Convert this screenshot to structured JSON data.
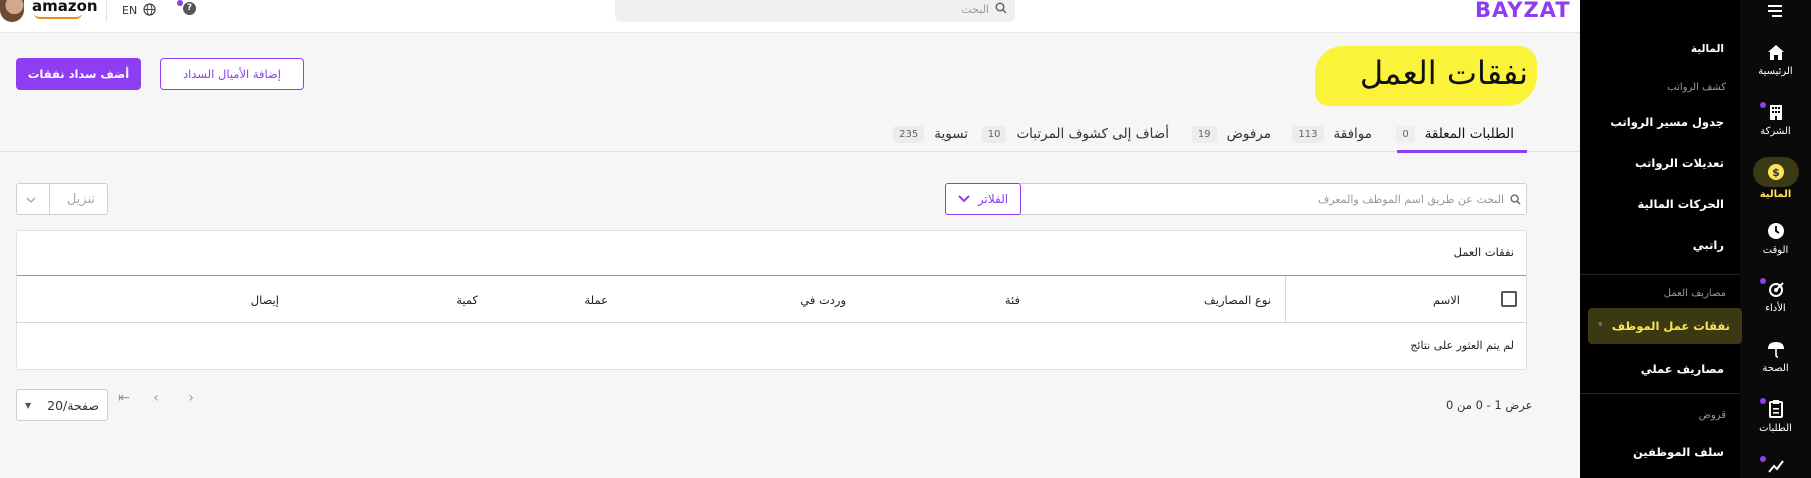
{
  "app": {
    "logo": "BAYZAT",
    "language": "EN",
    "company_logo": "amazon"
  },
  "search": {
    "placeholder": "البحث"
  },
  "rail": {
    "items": [
      {
        "label": "الرئيسية",
        "icon": "home-icon"
      },
      {
        "label": "الشركة",
        "icon": "building-icon"
      },
      {
        "label": "المالية",
        "icon": "dollar-icon",
        "active": true
      },
      {
        "label": "الوقت",
        "icon": "clock-icon"
      },
      {
        "label": "الأداء",
        "icon": "performance-icon"
      },
      {
        "label": "الصحة",
        "icon": "health-icon"
      },
      {
        "label": "الطلبات",
        "icon": "requests-icon"
      }
    ]
  },
  "subnav": {
    "header": "المالية",
    "sections": [
      {
        "title": "كشف الرواتب",
        "items": [
          "جدول مسير الرواتب",
          "تعديلات الرواتب",
          "الحركات المالية",
          "راتبي"
        ]
      },
      {
        "title": "مصاريف العمل",
        "items": [
          "نفقات عمل الموظف",
          "مصاريف عملي"
        ]
      },
      {
        "title": "قروض",
        "items": [
          "سلف الموظفين"
        ]
      }
    ],
    "active_item": "نفقات عمل الموظف"
  },
  "page": {
    "title": "نفقات العمل",
    "add_button": "أضف سداد نفقات",
    "miles_button": "إضافة الأميال السداد"
  },
  "tabs": [
    {
      "label": "الطلبات المعلقة",
      "count": "0",
      "active": true
    },
    {
      "label": "موافقة",
      "count": "113"
    },
    {
      "label": "مرفوض",
      "count": "19"
    },
    {
      "label": "أضاف إلى كشوف المرتبات",
      "count": "10"
    },
    {
      "label": "تسوية",
      "count": "235"
    }
  ],
  "filters": {
    "search_placeholder": "البحث عن طريق اسم الموظف والمعرف",
    "filters_label": "الفلاتر",
    "download_label": "تنزيل"
  },
  "table": {
    "title": "نفقات العمل",
    "columns": [
      "الاسم",
      "نوع المصاريف",
      "فئة",
      "وردت في",
      "عملة",
      "كمية",
      "إيصال"
    ],
    "empty_text": "لم يتم العثور على نتائج"
  },
  "pagination": {
    "range_text": "عرض 1 - 0 من 0",
    "rows_per_page": "20/صفحة"
  },
  "colors": {
    "accent": "#8e3df0",
    "highlight": "#fbf23a",
    "active_nav_text": "#ffe35a"
  }
}
